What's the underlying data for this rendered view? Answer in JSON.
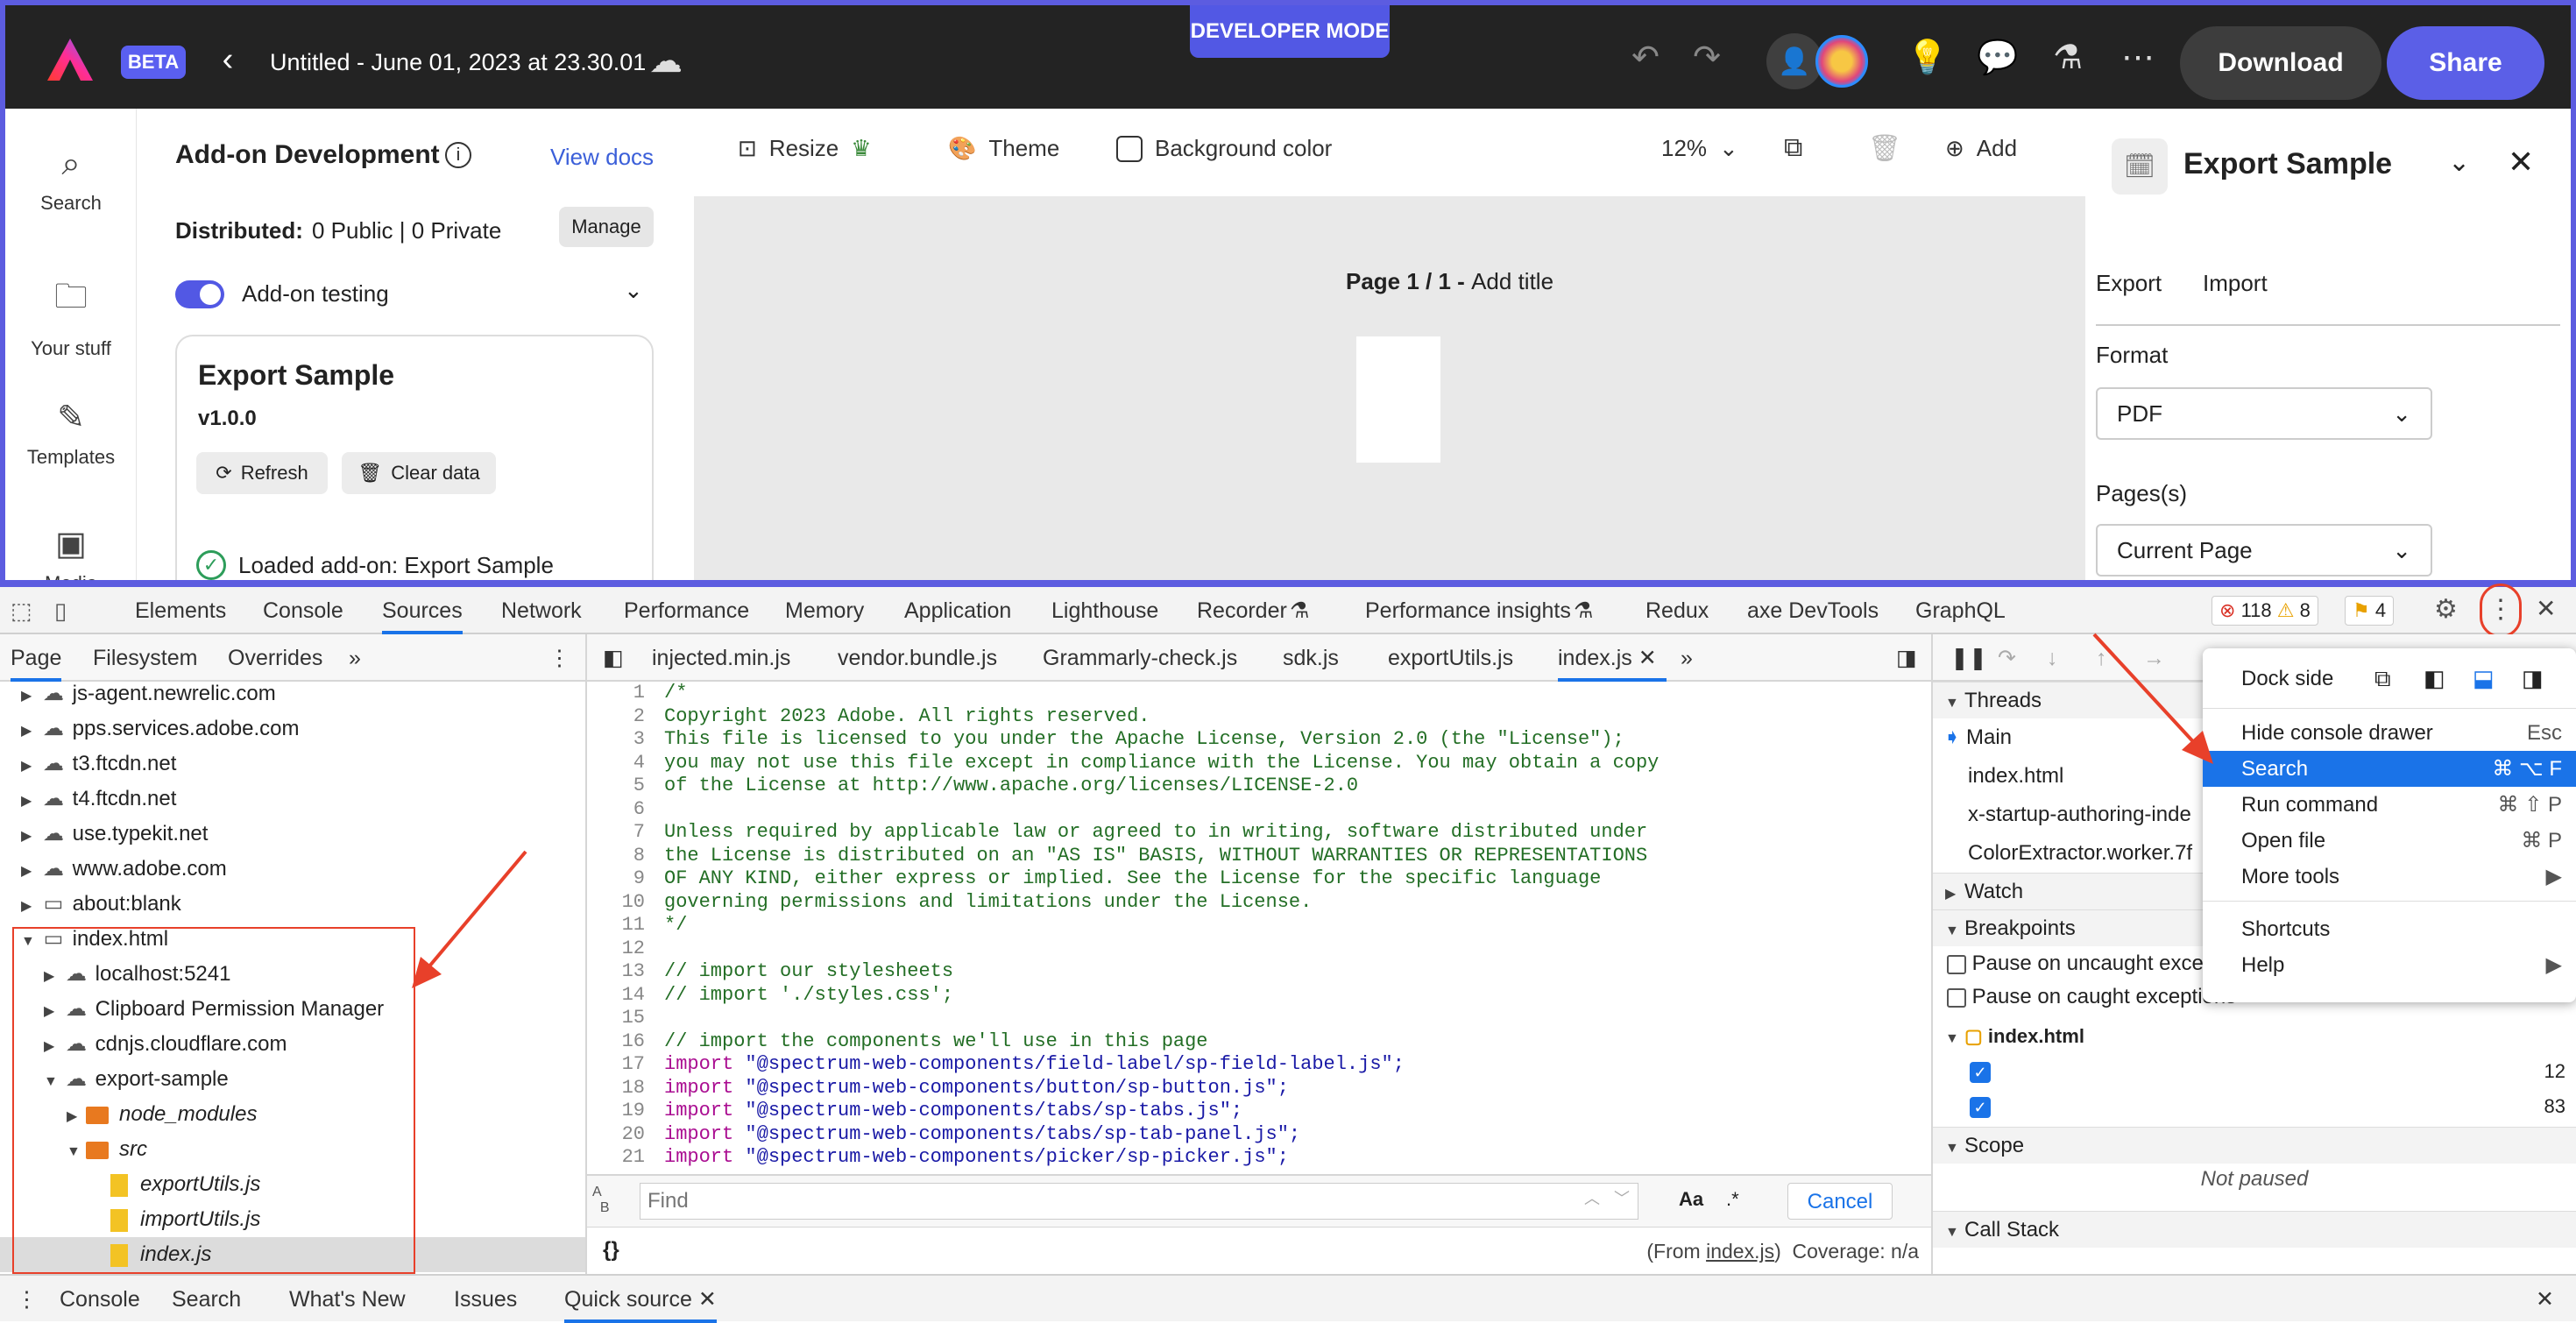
{
  "topbar": {
    "beta": "BETA",
    "title": "Untitled - June 01, 2023 at 23.30.01",
    "developer_mode": "DEVELOPER MODE",
    "download": "Download",
    "share": "Share"
  },
  "rail": {
    "items": [
      "Search",
      "Your stuff",
      "Templates",
      "Media"
    ]
  },
  "addon_panel": {
    "title": "Add-on Development",
    "view_docs": "View docs",
    "distributed_label": "Distributed:",
    "distributed_value": "0 Public | 0 Private",
    "manage": "Manage",
    "testing": "Add-on testing",
    "card_title": "Export Sample",
    "version": "v1.0.0",
    "refresh": "Refresh",
    "clear_data": "Clear data",
    "loaded": "Loaded add-on: Export Sample"
  },
  "canvas": {
    "resize": "Resize",
    "theme": "Theme",
    "background": "Background color",
    "zoom": "12%",
    "add": "Add",
    "page_label": "Page 1 / 1 - ",
    "page_title": "Add title"
  },
  "right_panel": {
    "title": "Export Sample",
    "tab_export": "Export",
    "tab_import": "Import",
    "format_label": "Format",
    "format_value": "PDF",
    "pages_label": "Pages(s)",
    "pages_value": "Current Page"
  },
  "devtools": {
    "tabs": [
      "Elements",
      "Console",
      "Sources",
      "Network",
      "Performance",
      "Memory",
      "Application",
      "Lighthouse",
      "Recorder",
      "Performance insights",
      "Redux",
      "axe DevTools",
      "GraphQL"
    ],
    "errors": "118",
    "warnings": "8",
    "issues": "4",
    "nav_tabs": [
      "Page",
      "Filesystem",
      "Overrides"
    ],
    "file_tabs": [
      "injected.min.js",
      "vendor.bundle.js",
      "Grammarly-check.js",
      "sdk.js",
      "exportUtils.js",
      "index.js"
    ],
    "tree": [
      "js-agent.newrelic.com",
      "pps.services.adobe.com",
      "t3.ftcdn.net",
      "t4.ftcdn.net",
      "use.typekit.net",
      "www.adobe.com",
      "about:blank",
      "index.html",
      "localhost:5241",
      "Clipboard Permission Manager",
      "cdnjs.cloudflare.com",
      "export-sample",
      "node_modules",
      "src",
      "exportUtils.js",
      "importUtils.js",
      "index.js"
    ],
    "code_lines": [
      "/*",
      "Copyright 2023 Adobe. All rights reserved.",
      "This file is licensed to you under the Apache License, Version 2.0 (the \"License\");",
      "you may not use this file except in compliance with the License. You may obtain a copy",
      "of the License at http://www.apache.org/licenses/LICENSE-2.0",
      "",
      "Unless required by applicable law or agreed to in writing, software distributed under",
      "the License is distributed on an \"AS IS\" BASIS, WITHOUT WARRANTIES OR REPRESENTATIONS",
      "OF ANY KIND, either express or implied. See the License for the specific language",
      "governing permissions and limitations under the License.",
      "*/",
      "",
      "// import our stylesheets",
      "// import './styles.css';",
      "",
      "// import the components we'll use in this page"
    ],
    "imports": [
      "\"@spectrum-web-components/field-label/sp-field-label.js\";",
      "\"@spectrum-web-components/button/sp-button.js\";",
      "\"@spectrum-web-components/tabs/sp-tabs.js\";",
      "\"@spectrum-web-components/tabs/sp-tab-panel.js\";",
      "\"@spectrum-web-components/picker/sp-picker.js\";"
    ],
    "import_kw": "import",
    "find_placeholder": "Find",
    "cancel": "Cancel",
    "from_label": "(From ",
    "from_file": "index.js",
    "coverage": "Coverage: n/a",
    "threads": "Threads",
    "thread_items": [
      "Main",
      "index.html",
      "x-startup-authoring-inde",
      "ColorExtractor.worker.7f"
    ],
    "watch": "Watch",
    "breakpoints": "Breakpoints",
    "pause_uncaught": "Pause on uncaught exce",
    "pause_caught": "Pause on caught exceptions",
    "bp_file": "index.html",
    "bp_lines": [
      "12",
      "83"
    ],
    "scope": "Scope",
    "not_paused": "Not paused",
    "call_stack": "Call Stack",
    "drawer_tabs": [
      "Console",
      "Search",
      "What's New",
      "Issues",
      "Quick source"
    ]
  },
  "menu": {
    "dock_side": "Dock side",
    "items": [
      {
        "label": "Hide console drawer",
        "shortcut": "Esc"
      },
      {
        "label": "Search",
        "shortcut": "⌘ ⌥ F"
      },
      {
        "label": "Run command",
        "shortcut": "⌘ ⇧ P"
      },
      {
        "label": "Open file",
        "shortcut": "⌘ P"
      },
      {
        "label": "More tools",
        "shortcut": "▶"
      },
      {
        "label": "Shortcuts",
        "shortcut": ""
      },
      {
        "label": "Help",
        "shortcut": "▶"
      }
    ]
  },
  "colors": {
    "accent": "#5c5ce0",
    "annotation_red": "#e8402a",
    "devtools_blue": "#1a73e8"
  }
}
